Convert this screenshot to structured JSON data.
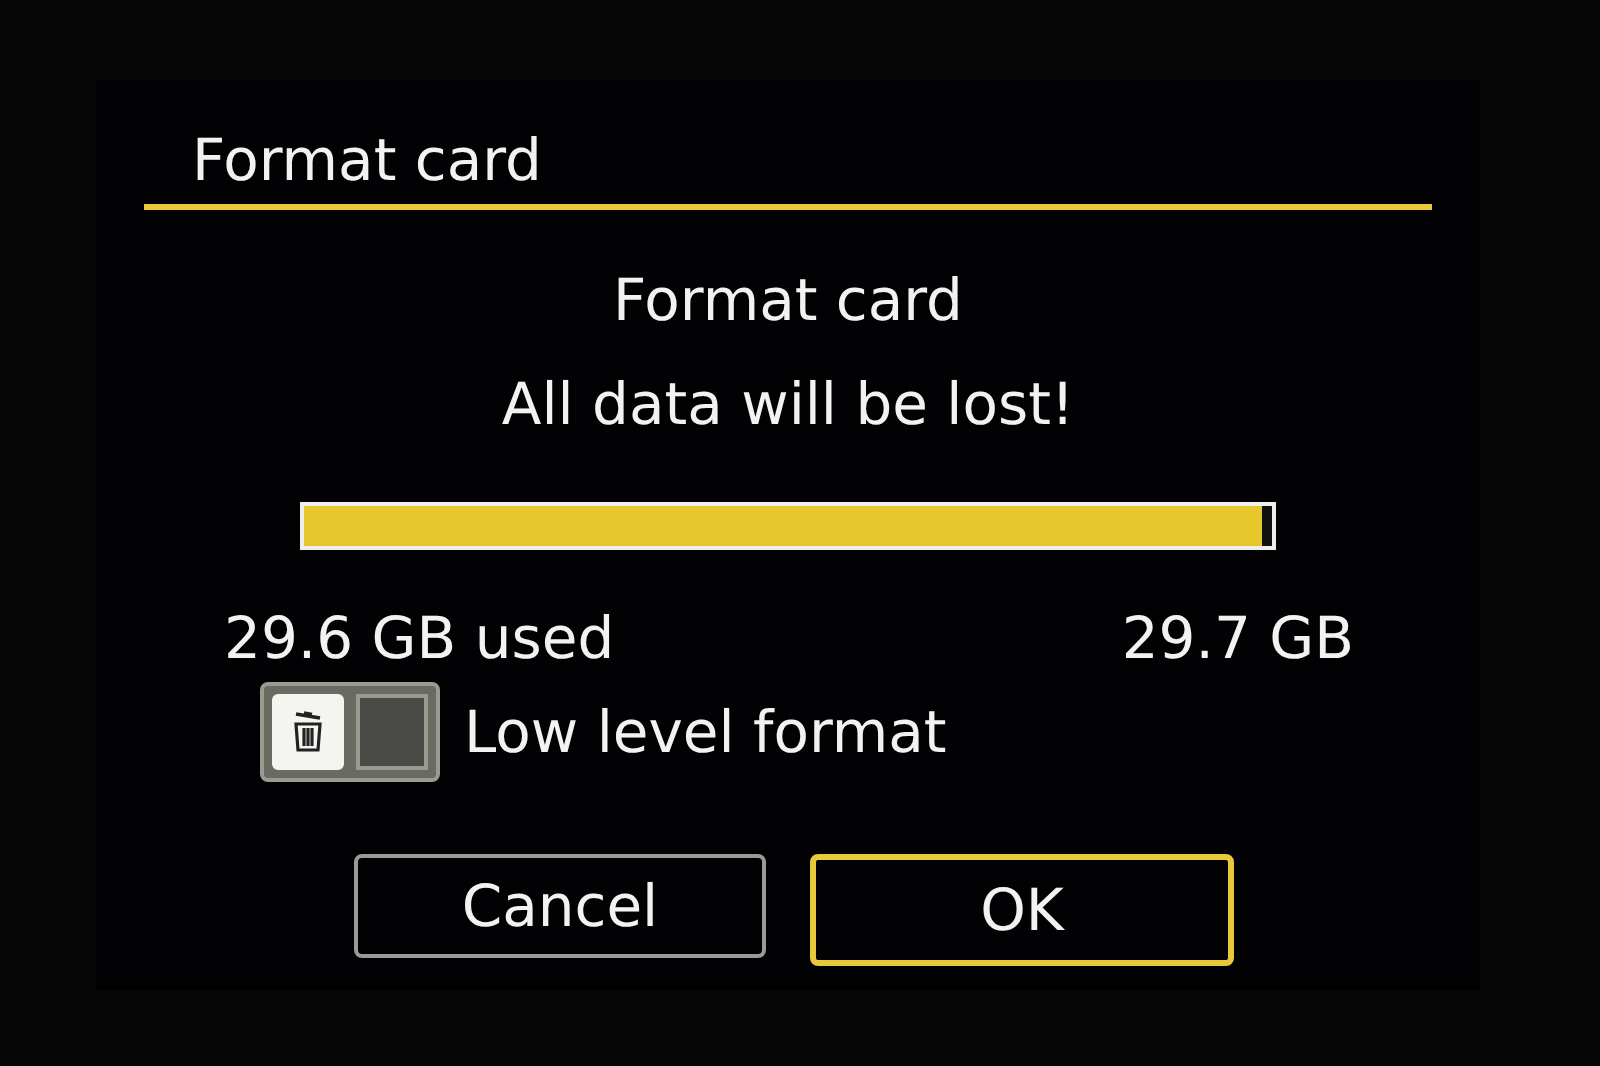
{
  "title": "Format card",
  "message": [
    "Format card",
    "All data will be lost!"
  ],
  "usage": {
    "level": 0.99,
    "used": "29.6 GB used",
    "total": "29.7 GB"
  },
  "low_level_format": {
    "label": "Low level format",
    "checked": false
  },
  "buttons": [
    {
      "label": "Cancel",
      "selected": false
    },
    {
      "label": "OK",
      "selected": true
    }
  ]
}
